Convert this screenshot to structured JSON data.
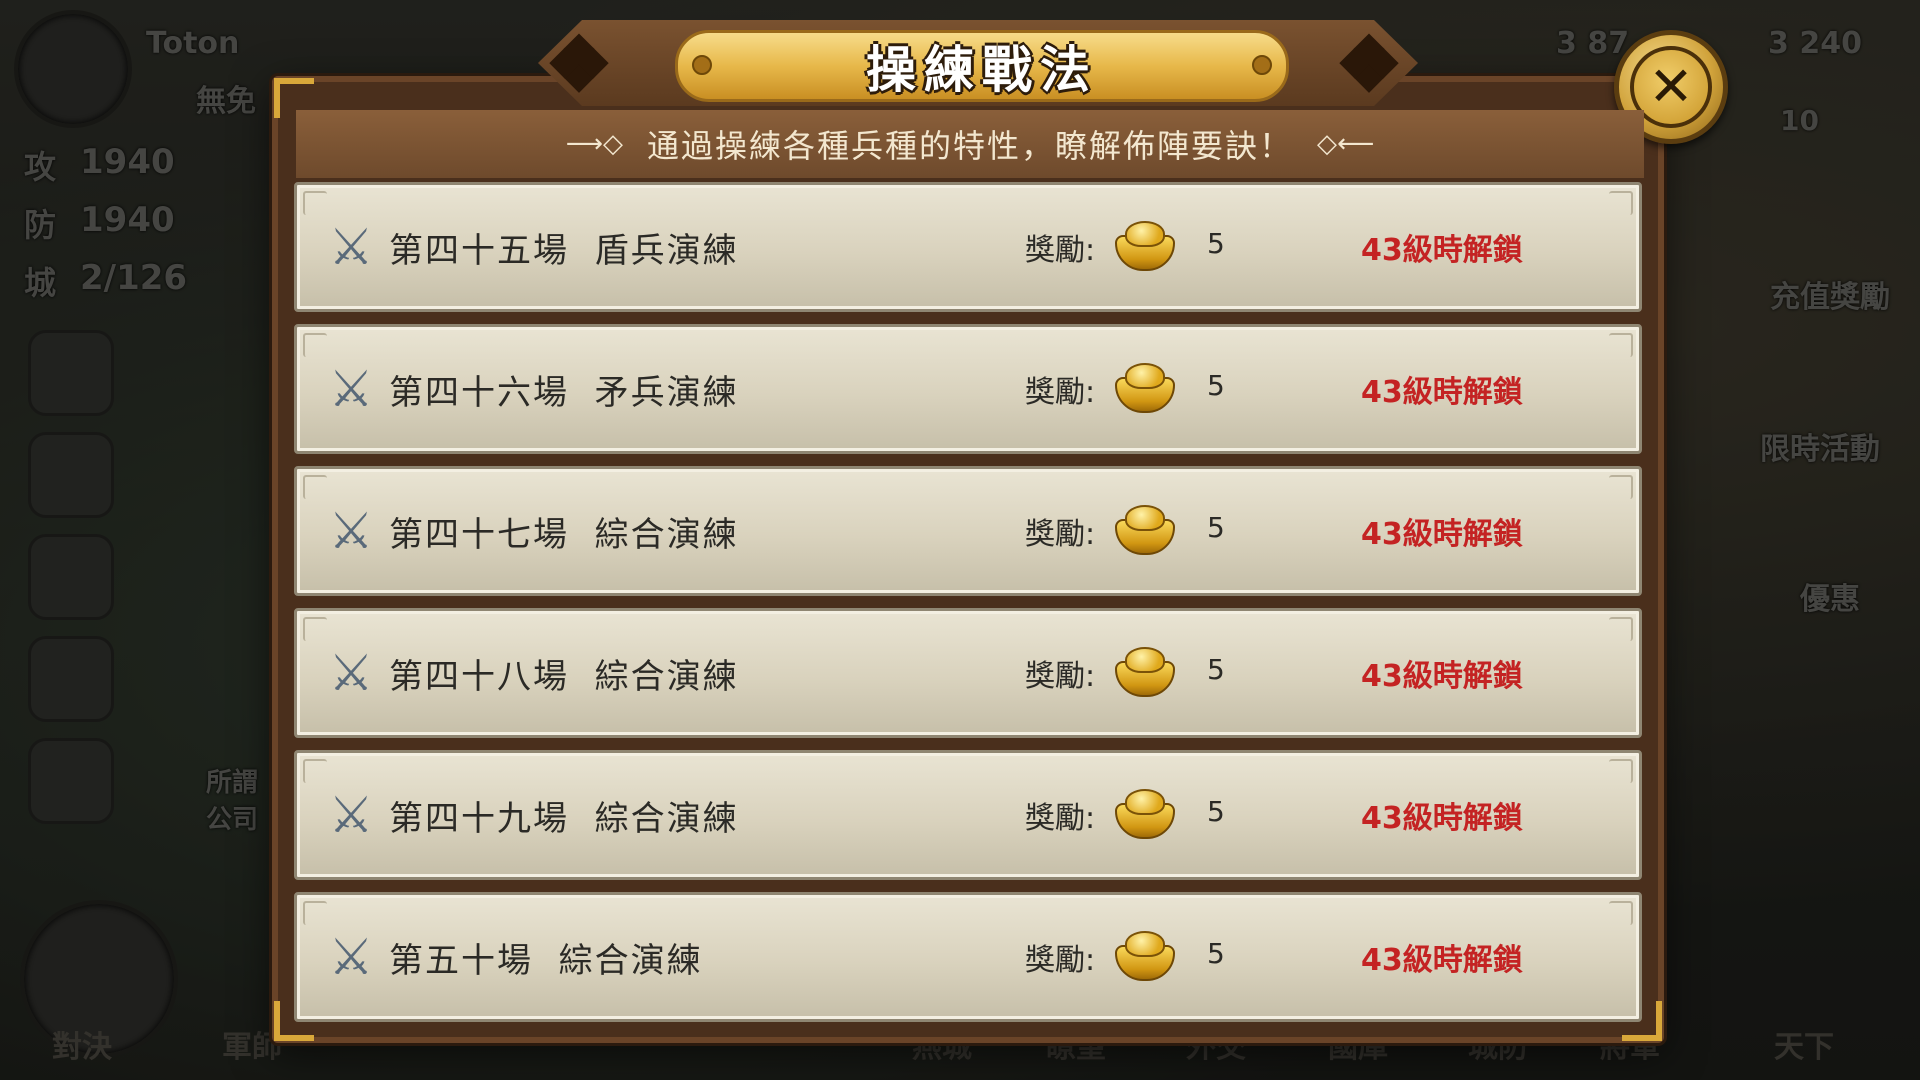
{
  "hud": {
    "player_name": "Toton",
    "status": "無免",
    "attack_label": "攻",
    "attack_value": "1940",
    "defense_label": "防",
    "defense_value": "1940",
    "city_label": "城",
    "city_value": "2/126",
    "currency_1": "3 87",
    "currency_2": "3 240",
    "stamina": "10",
    "right_menu": [
      "充值獎勵",
      "限時活動",
      "優惠"
    ],
    "bottom_nav": [
      "對決",
      "軍師",
      "燕城",
      "瞭望",
      "外交",
      "國庫",
      "城防",
      "將軍",
      "天下"
    ],
    "chat_snippet": "所謂 公司"
  },
  "dialog": {
    "title": "操練戰法",
    "subtitle": "通過操練各種兵種的特性，瞭解佈陣要訣！",
    "close_symbol": "✕",
    "reward_label": "獎勵:",
    "rows": [
      {
        "stage": "第四十五場",
        "name": "盾兵演練",
        "amount": "5",
        "unlock": "43級時解鎖"
      },
      {
        "stage": "第四十六場",
        "name": "矛兵演練",
        "amount": "5",
        "unlock": "43級時解鎖"
      },
      {
        "stage": "第四十七場",
        "name": "綜合演練",
        "amount": "5",
        "unlock": "43級時解鎖"
      },
      {
        "stage": "第四十八場",
        "name": "綜合演練",
        "amount": "5",
        "unlock": "43級時解鎖"
      },
      {
        "stage": "第四十九場",
        "name": "綜合演練",
        "amount": "5",
        "unlock": "43級時解鎖"
      },
      {
        "stage": "第五十場",
        "name": "綜合演練",
        "amount": "5",
        "unlock": "43級時解鎖"
      }
    ]
  }
}
